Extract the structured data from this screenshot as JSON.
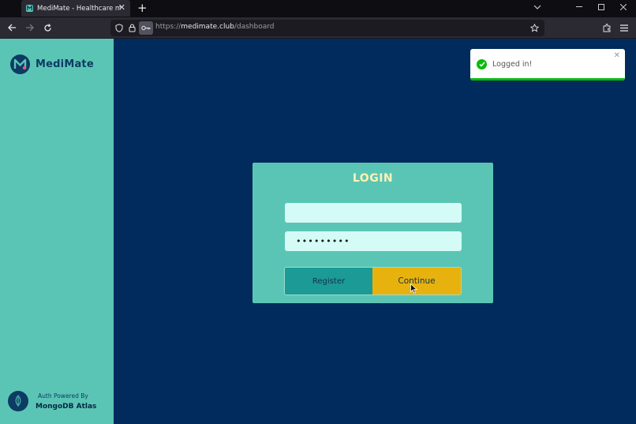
{
  "browser": {
    "tab_title": "MediMate - Healthcare made si",
    "tab_close": "✕",
    "new_tab": "+",
    "url_scheme": "https://",
    "url_host": "medimate.club",
    "url_path": "/dashboard"
  },
  "sidebar": {
    "brand": "MediMate",
    "auth_label": "Auth Powered By",
    "auth_name": "MongoDB Atlas"
  },
  "login": {
    "title": "LOGIN",
    "username_value": "",
    "password_value": "•••••••••",
    "register_label": "Register",
    "continue_label": "Continue"
  },
  "toast": {
    "message": "Logged in!",
    "close": "✕",
    "progress": 1.0
  },
  "colors": {
    "page_bg": "#002b5c",
    "sidebar_bg": "#5bc5b5",
    "continue_bg": "#e8b20e",
    "register_bg": "#1b9a96",
    "success": "#07bc0c"
  }
}
